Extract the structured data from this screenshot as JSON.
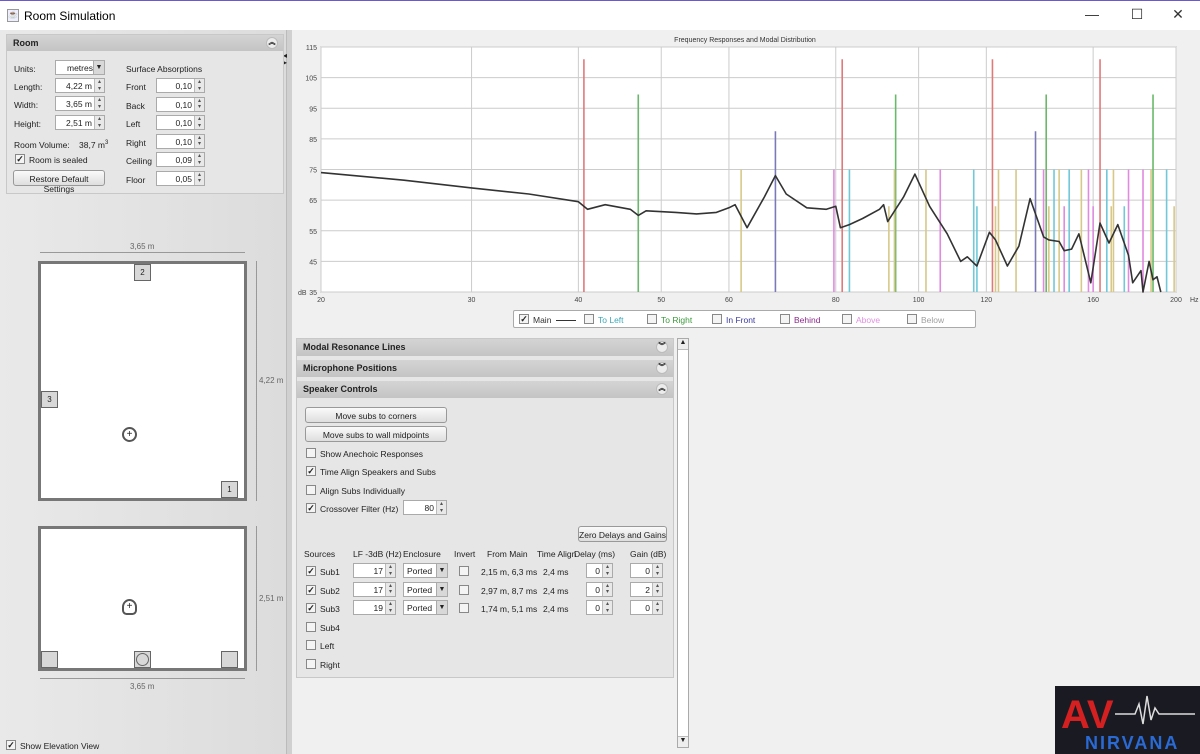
{
  "window": {
    "title": "Room Simulation",
    "minimize": "—",
    "maximize": "☐",
    "close": "✕"
  },
  "room": {
    "header": "Room",
    "units_label": "Units:",
    "units_value": "metres",
    "length_label": "Length:",
    "length": "4,22 m",
    "width_label": "Width:",
    "width": "3,65 m",
    "height_label": "Height:",
    "height": "2,51 m",
    "volume_label": "Room Volume:",
    "volume": "38,7 m",
    "volume_sup": "3",
    "sealed_label": "Room is sealed",
    "sealed": true,
    "restore_label": "Restore Default Settings",
    "absorption_title": "Surface Absorptions",
    "absorptions": [
      {
        "label": "Front",
        "value": "0,10"
      },
      {
        "label": "Back",
        "value": "0,10"
      },
      {
        "label": "Left",
        "value": "0,10"
      },
      {
        "label": "Right",
        "value": "0,10"
      },
      {
        "label": "Ceiling",
        "value": "0,09"
      },
      {
        "label": "Floor",
        "value": "0,05"
      }
    ]
  },
  "plan": {
    "width_dim": "3,65 m",
    "length_dim": "4,22 m",
    "height_dim": "2,51 m",
    "elev_width_dim": "3,65 m",
    "speakers": [
      "1",
      "2",
      "3"
    ]
  },
  "show_elevation": {
    "label": "Show Elevation View",
    "checked": true
  },
  "sections": {
    "modal": "Modal Resonance Lines",
    "mic": "Microphone Positions",
    "speaker": "Speaker Controls"
  },
  "speaker_controls": {
    "corners": "Move subs to corners",
    "midpoints": "Move subs to wall midpoints",
    "options": [
      {
        "label": "Show Anechoic Responses",
        "checked": false
      },
      {
        "label": "Time Align Speakers and Subs",
        "checked": true
      },
      {
        "label": "Align Subs Individually",
        "checked": false
      },
      {
        "label": "Crossover Filter (Hz)",
        "checked": true
      }
    ],
    "crossover": "80",
    "zero": "Zero Delays and Gains",
    "headers": [
      "Sources",
      "LF -3dB (Hz)",
      "Enclosure",
      "Invert",
      "From Main",
      "Time Align",
      "Delay (ms)",
      "Gain (dB)"
    ],
    "rows": [
      {
        "name": "Sub1",
        "checked": true,
        "lf": "17",
        "enc": "Ported",
        "invert": false,
        "from": "2,15 m, 6,3 ms",
        "align": "2,4 ms",
        "delay": "0",
        "gain": "0"
      },
      {
        "name": "Sub2",
        "checked": true,
        "lf": "17",
        "enc": "Ported",
        "invert": false,
        "from": "2,97 m, 8,7 ms",
        "align": "2,4 ms",
        "delay": "0",
        "gain": "2"
      },
      {
        "name": "Sub3",
        "checked": true,
        "lf": "19",
        "enc": "Ported",
        "invert": false,
        "from": "1,74 m, 5,1 ms",
        "align": "2,4 ms",
        "delay": "0",
        "gain": "0"
      },
      {
        "name": "Sub4",
        "checked": false
      },
      {
        "name": "Left",
        "checked": false
      },
      {
        "name": "Right",
        "checked": false
      }
    ]
  },
  "logo": {
    "text_top": "AV",
    "text_bottom": "NIRVANA"
  },
  "chart_data": {
    "type": "line",
    "title": "Frequency Responses and Modal Distribution",
    "xscale": "log",
    "xlim": [
      20,
      200
    ],
    "ylim": [
      35,
      115
    ],
    "xunit": "Hz",
    "yunit": "dB",
    "grid": true,
    "xticks": [
      20,
      30,
      40,
      50,
      60,
      80,
      100,
      120,
      160,
      200
    ],
    "yticks": [
      35,
      45,
      55,
      65,
      75,
      85,
      95,
      105,
      115
    ],
    "series": [
      {
        "name": "Main",
        "color": "#333333",
        "x": [
          20,
          25,
          30,
          35,
          40,
          41,
          43,
          46,
          47,
          48,
          52,
          55,
          58,
          60,
          61,
          63,
          66,
          68,
          70,
          74,
          78,
          80,
          81,
          83,
          86,
          90,
          91,
          92,
          96,
          99,
          103,
          108,
          112,
          114,
          117,
          121,
          123,
          127,
          131,
          135,
          140,
          142,
          146,
          148,
          151,
          154,
          159,
          163,
          167,
          171,
          176,
          178,
          182,
          183,
          186,
          188,
          190,
          192
        ],
        "y": [
          74,
          71.5,
          69,
          67,
          64.5,
          62,
          63.5,
          62,
          60,
          61.5,
          61,
          60.5,
          61,
          62.5,
          63.5,
          56,
          66,
          73,
          67,
          62.5,
          62,
          63,
          56,
          57,
          59,
          62,
          63.5,
          58,
          66,
          73.5,
          63,
          54,
          45,
          46.5,
          43.5,
          54.5,
          52,
          43.5,
          50,
          65.5,
          53,
          52,
          51.5,
          48.5,
          49,
          54,
          38,
          57.5,
          51,
          57,
          47,
          38,
          42,
          35,
          45,
          39,
          40,
          35
        ]
      }
    ],
    "legend": [
      {
        "label": "Main",
        "checked": true,
        "color": "#333333"
      },
      {
        "label": "To Left",
        "checked": false,
        "color": "#3aa8b8"
      },
      {
        "label": "To Right",
        "checked": false,
        "color": "#3a9a3a"
      },
      {
        "label": "In Front",
        "checked": false,
        "color": "#3a3aa0"
      },
      {
        "label": "Behind",
        "checked": false,
        "color": "#8a2a8a"
      },
      {
        "label": "Above",
        "checked": false,
        "color": "#e090e0"
      },
      {
        "label": "Below",
        "checked": false,
        "color": "#a0a0a0"
      }
    ],
    "legend_placement": "bottom",
    "modal_lines": [
      {
        "f": 40.6,
        "level": 111,
        "color": "#e07a7a"
      },
      {
        "f": 81.4,
        "level": 111,
        "color": "#e07a7a"
      },
      {
        "f": 122,
        "level": 111,
        "color": "#e07a7a"
      },
      {
        "f": 163,
        "level": 111,
        "color": "#e07a7a"
      },
      {
        "f": 47,
        "level": 99.5,
        "color": "#6ab86a"
      },
      {
        "f": 94,
        "level": 99.5,
        "color": "#6ab86a"
      },
      {
        "f": 141,
        "level": 99.5,
        "color": "#6ab86a"
      },
      {
        "f": 188,
        "level": 99.5,
        "color": "#6ab86a"
      },
      {
        "f": 68,
        "level": 87.5,
        "color": "#7a7ab8"
      },
      {
        "f": 137,
        "level": 87.5,
        "color": "#7a7ab8"
      },
      {
        "f": 62,
        "level": 75,
        "color": "#d8c888"
      },
      {
        "f": 79.6,
        "level": 75,
        "color": "#e08ae0"
      },
      {
        "f": 83,
        "level": 75,
        "color": "#70c8d8"
      },
      {
        "f": 92.3,
        "level": 63,
        "color": "#d8c888"
      },
      {
        "f": 93.7,
        "level": 75,
        "color": "#d8c888"
      },
      {
        "f": 102,
        "level": 75,
        "color": "#d8c888"
      },
      {
        "f": 106,
        "level": 75,
        "color": "#e08ae0"
      },
      {
        "f": 116,
        "level": 75,
        "color": "#70c8d8"
      },
      {
        "f": 117,
        "level": 63,
        "color": "#70c8d8"
      },
      {
        "f": 124,
        "level": 75,
        "color": "#d8c888"
      },
      {
        "f": 123,
        "level": 63,
        "color": "#d8c888"
      },
      {
        "f": 130,
        "level": 75,
        "color": "#d8c888"
      },
      {
        "f": 140,
        "level": 75,
        "color": "#e08ae0"
      },
      {
        "f": 142,
        "level": 63,
        "color": "#d8c888"
      },
      {
        "f": 144,
        "level": 75,
        "color": "#70c8d8"
      },
      {
        "f": 146,
        "level": 75,
        "color": "#d8c888"
      },
      {
        "f": 148,
        "level": 63,
        "color": "#e08ae0"
      },
      {
        "f": 150,
        "level": 75,
        "color": "#70c8d8"
      },
      {
        "f": 155,
        "level": 75,
        "color": "#d8c888"
      },
      {
        "f": 158,
        "level": 75,
        "color": "#e08ae0"
      },
      {
        "f": 160,
        "level": 63,
        "color": "#e08ae0"
      },
      {
        "f": 166,
        "level": 75,
        "color": "#70c8d8"
      },
      {
        "f": 168,
        "level": 63,
        "color": "#d8c888"
      },
      {
        "f": 169,
        "level": 75,
        "color": "#d8c888"
      },
      {
        "f": 174,
        "level": 63,
        "color": "#70c8d8"
      },
      {
        "f": 176,
        "level": 75,
        "color": "#e08ae0"
      },
      {
        "f": 183,
        "level": 75,
        "color": "#e08ae0"
      },
      {
        "f": 187,
        "level": 75,
        "color": "#d8c888"
      },
      {
        "f": 195,
        "level": 75,
        "color": "#70c8d8"
      },
      {
        "f": 199,
        "level": 63,
        "color": "#d8c888"
      }
    ]
  }
}
